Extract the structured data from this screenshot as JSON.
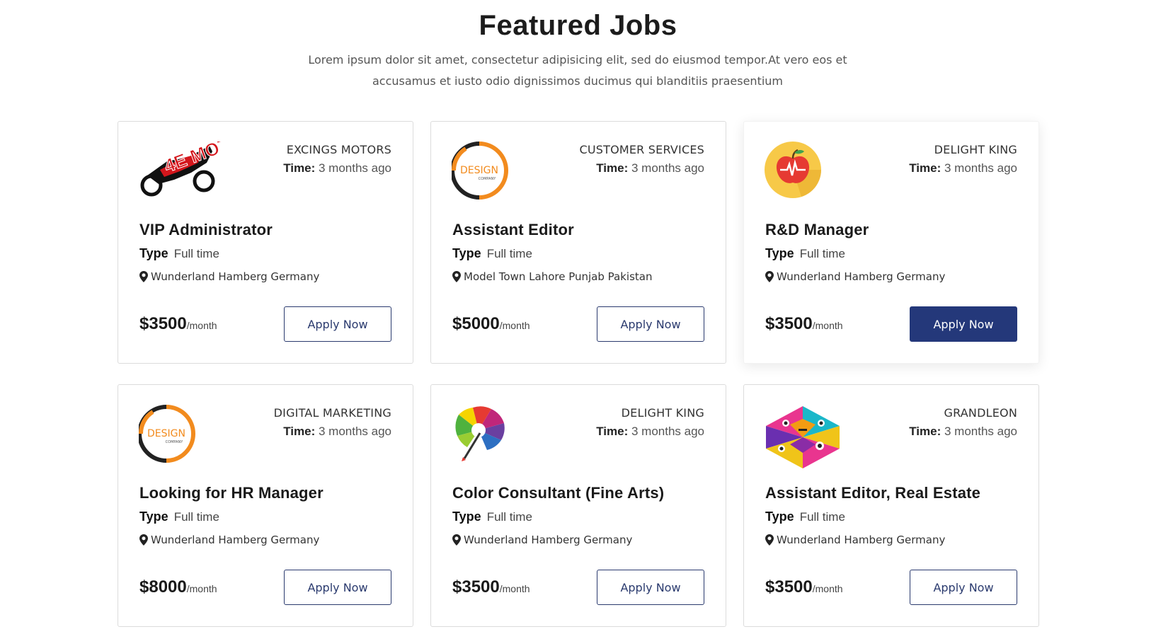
{
  "section": {
    "title": "Featured Jobs",
    "subtitle_line1": "Lorem ipsum dolor sit amet, consectetur adipisicing elit, sed do eiusmod tempor.At vero eos et",
    "subtitle_line2": "accusamus et iusto odio dignissimos ducimus qui blanditiis praesentium"
  },
  "colors": {
    "accent": "#24387a",
    "border": "#dcdcdc"
  },
  "labels": {
    "time": "Time:",
    "type": "Type",
    "per_month": "/month",
    "apply": "Apply Now"
  },
  "jobs": [
    {
      "company": "EXCINGS MOTORS",
      "time": "3 months ago",
      "title": "VIP Administrator",
      "type": "Full time",
      "location": "Wunderland Hamberg Germany",
      "salary": "$3500",
      "logo_text": "4E MOTORSPORTS",
      "logo_icon": "motorsports-logo-icon"
    },
    {
      "company": "CUSTOMER SERVICES",
      "time": "3 months ago",
      "title": "Assistant Editor",
      "type": "Full time",
      "location": "Model Town Lahore Punjab Pakistan",
      "salary": "$5000",
      "logo_text": "DESIGN",
      "logo_sub": "COMPANY",
      "logo_icon": "design-company-logo-icon"
    },
    {
      "company": "DELIGHT KING",
      "time": "3 months ago",
      "title": "R&D Manager",
      "type": "Full time",
      "location": "Wunderland Hamberg Germany",
      "salary": "$3500",
      "logo_icon": "apple-heartbeat-logo-icon"
    },
    {
      "company": "DIGITAL MARKETING",
      "time": "3 months ago",
      "title": "Looking for HR Manager",
      "type": "Full time",
      "location": "Wunderland Hamberg Germany",
      "salary": "$8000",
      "logo_text": "DESIGN",
      "logo_sub": "COMPANY",
      "logo_icon": "design-company-logo-icon"
    },
    {
      "company": "DELIGHT KING",
      "time": "3 months ago",
      "title": "Color Consultant (Fine Arts)",
      "type": "Full time",
      "location": "Wunderland Hamberg Germany",
      "salary": "$3500",
      "logo_icon": "color-brush-logo-icon"
    },
    {
      "company": "GRANDLEON",
      "time": "3 months ago",
      "title": "Assistant Editor, Real Estate",
      "type": "Full time",
      "location": "Wunderland Hamberg Germany",
      "salary": "$3500",
      "logo_icon": "geometric-faces-logo-icon"
    }
  ]
}
